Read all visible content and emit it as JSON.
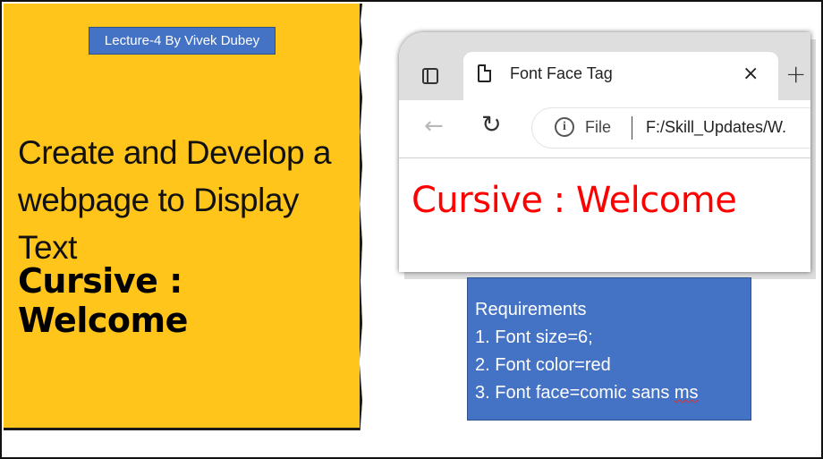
{
  "badge": "Lecture-4 By Vivek Dubey",
  "heading_lines": [
    "Create and Develop a",
    "webpage to Display",
    "Text"
  ],
  "cursive_heading": "Cursive : Welcome",
  "browser": {
    "tab_title": "Font Face Tag",
    "close_symbol": "×",
    "newtab_symbol": "+",
    "back_symbol": "←",
    "reload_symbol": "↻",
    "info_symbol": "i",
    "address_scheme": "File",
    "address_url": "F:/Skill_Updates/W.",
    "content_text": "Cursive : Welcome",
    "content_color": "#ff0000"
  },
  "requirements": {
    "title": "Requirements",
    "items": [
      "1. Font size=6;",
      "2. Font color=red",
      "3. Font face=comic sans "
    ],
    "last_word": "ms"
  },
  "colors": {
    "note_yellow": "#ffc51a",
    "box_blue": "#4472c4"
  }
}
